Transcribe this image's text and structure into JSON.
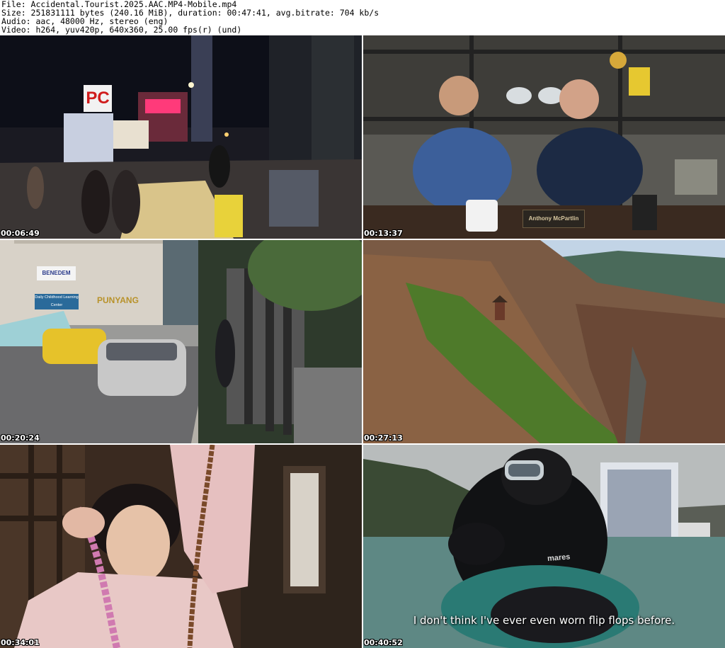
{
  "header": {
    "file": "File: Accidental.Tourist.2025.AAC.MP4-Mobile.mp4",
    "size": "Size: 251831111 bytes (240.16 MiB), duration: 00:47:41, avg.bitrate: 704 kb/s",
    "audio": "Audio: aac, 48000 Hz, stereo (eng)",
    "video": "Video: h264, yuv420p, 640x360, 25.00 fps(r) (und)"
  },
  "thumbnails": [
    {
      "timestamp": "00:06:49",
      "scene": "night-street",
      "signs": [
        "PC"
      ]
    },
    {
      "timestamp": "00:13:37",
      "scene": "office-two-men",
      "nameplate": "Anthony McPartlin"
    },
    {
      "timestamp": "00:20:24",
      "scene": "street-car",
      "signs": [
        "BENEDEM",
        "PUNYANG",
        "Daily Childhood Learning Center"
      ]
    },
    {
      "timestamp": "00:27:13",
      "scene": "mountain-aerial"
    },
    {
      "timestamp": "00:34:01",
      "scene": "woman-beads"
    },
    {
      "timestamp": "00:40:52",
      "scene": "diver",
      "subtitle": "I don't think I've ever even worn flip flops before.",
      "suit_text": "mares"
    }
  ],
  "colors": {
    "background": "#ffffff",
    "header_text": "#000000",
    "timestamp_text": "#ffffff"
  }
}
